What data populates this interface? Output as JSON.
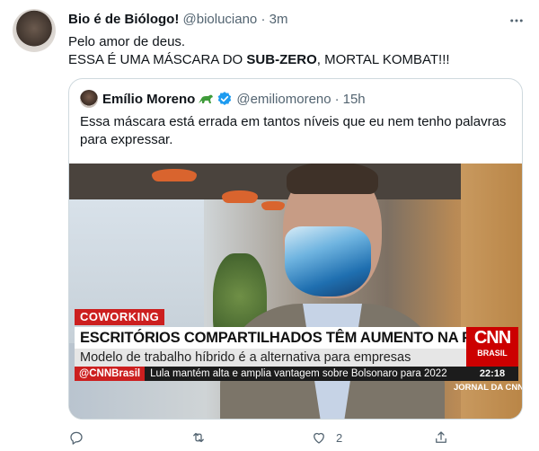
{
  "tweet": {
    "author_name": "Bio é de Biólogo!",
    "handle": "@bioluciano",
    "separator": "·",
    "time": "3m",
    "text_line1": "Pelo amor de deus.",
    "text_line2_pre": "ESSA É UMA MÁSCARA DO ",
    "text_line2_bold": "SUB-ZERO",
    "text_line2_post": ", MORTAL KOMBAT!!!"
  },
  "quote": {
    "author_name": "Emílio Moreno",
    "emoji": "dinosaur-icon",
    "handle": "@emiliomoreno",
    "separator": "·",
    "time": "15h",
    "text": "Essa máscara está errada em tantos níveis que eu nem tenho palavras para expressar."
  },
  "video": {
    "tag": "COWORKING",
    "headline": "ESCRITÓRIOS COMPARTILHADOS TÊM AUMENTO NA PROCURA",
    "subline": "Modelo de trabalho híbrido é a alternativa para empresas",
    "ticker_brand": "@CNNBrasil",
    "ticker_text": "Lula mantém alta e amplia vantagem sobre Bolsonaro para 2022",
    "logo_text": "CNN",
    "logo_sub": "BRASIL",
    "clock": "22:18",
    "program": "JORNAL DA CNN"
  },
  "actions": {
    "reply": {
      "icon": "reply-icon",
      "count": ""
    },
    "retweet": {
      "icon": "retweet-icon",
      "count": ""
    },
    "like": {
      "icon": "heart-icon",
      "count": "2"
    },
    "share": {
      "icon": "share-icon",
      "count": ""
    }
  },
  "colors": {
    "text": "#0f1419",
    "muted": "#536471",
    "verified": "#1d9bf0",
    "border": "#cfd9de",
    "cnn_red": "#cc0000"
  }
}
